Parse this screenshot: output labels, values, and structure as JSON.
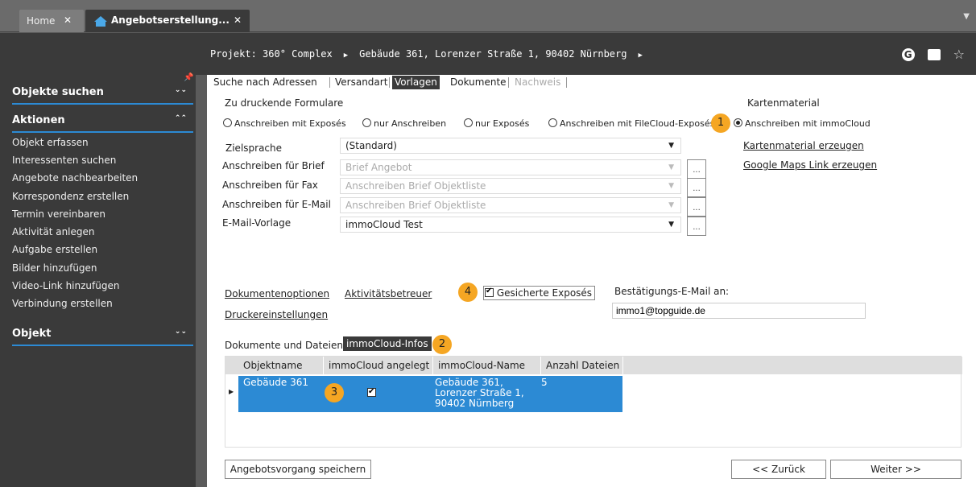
{
  "tabs": {
    "home": {
      "label": "Home",
      "close": "✕"
    },
    "active": {
      "label": "Angebotserstellung...",
      "close": "✕"
    }
  },
  "breadcrumb": {
    "project": "Projekt: 360° Complex",
    "building": "Gebäude 361, Lorenzer Straße 1, 90402 Nürnberg"
  },
  "sidebar": {
    "sections": [
      {
        "label": "Objekte suchen"
      },
      {
        "label": "Aktionen"
      },
      {
        "label": "Objekt"
      }
    ],
    "actions": [
      "Objekt erfassen",
      "Interessenten suchen",
      "Angebote nachbearbeiten",
      "Korrespondenz erstellen",
      "Termin vereinbaren",
      "Aktivität anlegen",
      "Aufgabe erstellen",
      "Bilder hinzufügen",
      "Video-Link hinzufügen",
      "Verbindung erstellen"
    ]
  },
  "nav": [
    "Suche nach Adressen",
    "Versandart",
    "Vorlagen",
    "Dokumente",
    "Nachweis"
  ],
  "forms": {
    "heading": "Zu druckende Formulare",
    "radios": [
      "Anschreiben mit Exposés",
      "nur Anschreiben",
      "nur Exposés",
      "Anschreiben mit FileCloud-Exposés",
      "Anschreiben mit immoCloud"
    ],
    "selected_radio": "Anschreiben mit immoCloud"
  },
  "map": {
    "heading": "Kartenmaterial",
    "link1": "Kartenmaterial erzeugen",
    "link2": "Google Maps Link erzeugen"
  },
  "fields": [
    {
      "label": "Zielsprache",
      "value": "(Standard)",
      "disabled": false
    },
    {
      "label": "Anschreiben für Brief",
      "value": "Brief Angebot",
      "disabled": true
    },
    {
      "label": "Anschreiben für Fax",
      "value": "Anschreiben Brief Objektliste",
      "disabled": true
    },
    {
      "label": "Anschreiben für E-Mail",
      "value": "Anschreiben Brief Objektliste",
      "disabled": true
    },
    {
      "label": "E-Mail-Vorlage",
      "value": "immoCloud Test",
      "disabled": false
    }
  ],
  "dots_label": "...",
  "options": {
    "doc_options": "Dokumentenoptionen",
    "activity": "Aktivitätsbetreuer",
    "printer": "Druckereinstellungen",
    "secured": "Gesicherte Exposés",
    "secured_checked": true,
    "confirm_label": "Bestätigungs-E-Mail an:",
    "confirm_email": "immo1@topguide.de"
  },
  "docs_tabs": {
    "tab1": "Dokumente und Dateien",
    "tab2": "immoCloud-Infos"
  },
  "grid": {
    "columns": [
      "Objektname",
      "immoCloud angelegt",
      "immoCloud-Name",
      "Anzahl Dateien"
    ],
    "rows": [
      {
        "name": "Gebäude 361",
        "created": true,
        "cloud_name": "Gebäude 361, Lorenzer Straße 1, 90402 Nürnberg",
        "files": "5"
      }
    ]
  },
  "badges": [
    "1",
    "2",
    "3",
    "4"
  ],
  "buttons": {
    "save": "Angebotsvorgang speichern",
    "back": "<< Zurück",
    "next": "Weiter >>"
  },
  "colors": {
    "accent": "#2c8ad4",
    "badge": "#f5a623",
    "dark": "#3a3a3a"
  }
}
